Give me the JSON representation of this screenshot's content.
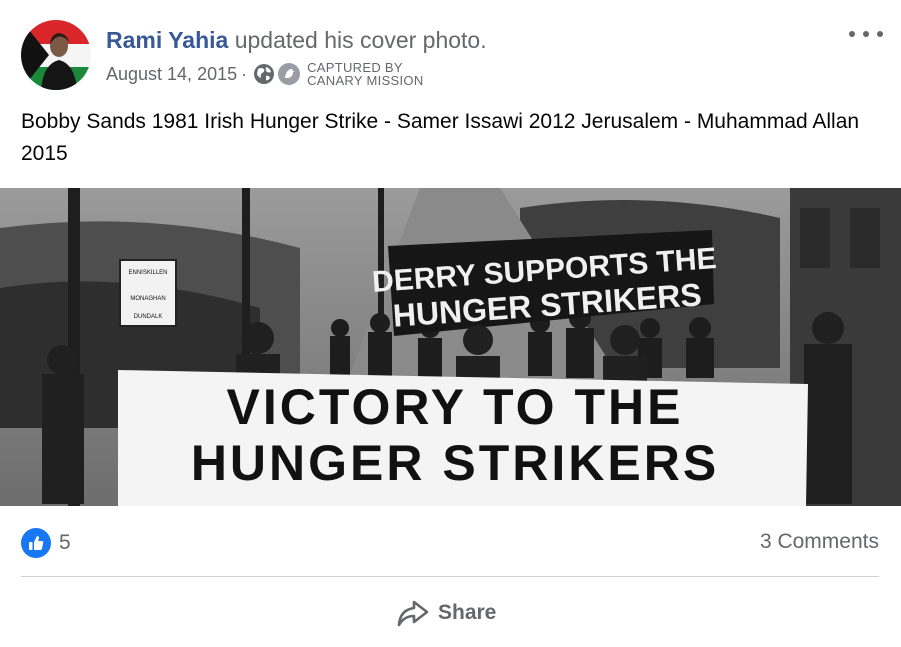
{
  "post": {
    "author": "Rami Yahia",
    "action": "updated his cover photo.",
    "date": "August 14, 2015",
    "date_separator": "·",
    "privacy_icon": "globe-icon",
    "watermark": {
      "line1": "CAPTURED BY",
      "line2": "CANARY MISSION"
    },
    "caption": "Bobby Sands 1981 Irish Hunger Strike - Samer Issawi 2012 Jerusalem - Muhammad Allan 2015",
    "more_icon": "more-options-icon"
  },
  "photo": {
    "banner_text_line1": "VICTORY TO THE",
    "banner_text_line2": "HUNGER STRIKERS",
    "sign_text_line1": "DERRY SUPPORTS THE",
    "sign_text_line2": "HUNGER STRIKERS",
    "road_sign": [
      "ENNISKILLEN",
      "MONAGHAN",
      "DUNDALK"
    ]
  },
  "reactions": {
    "icon": "like-icon",
    "count": "5"
  },
  "comments": {
    "label": "3 Comments"
  },
  "actions": {
    "share_label": "Share",
    "share_icon": "share-icon"
  },
  "colors": {
    "author": "#385898",
    "secondary_text": "#65676b",
    "like_blue": "#1877f2",
    "divider": "#ced0d4"
  }
}
